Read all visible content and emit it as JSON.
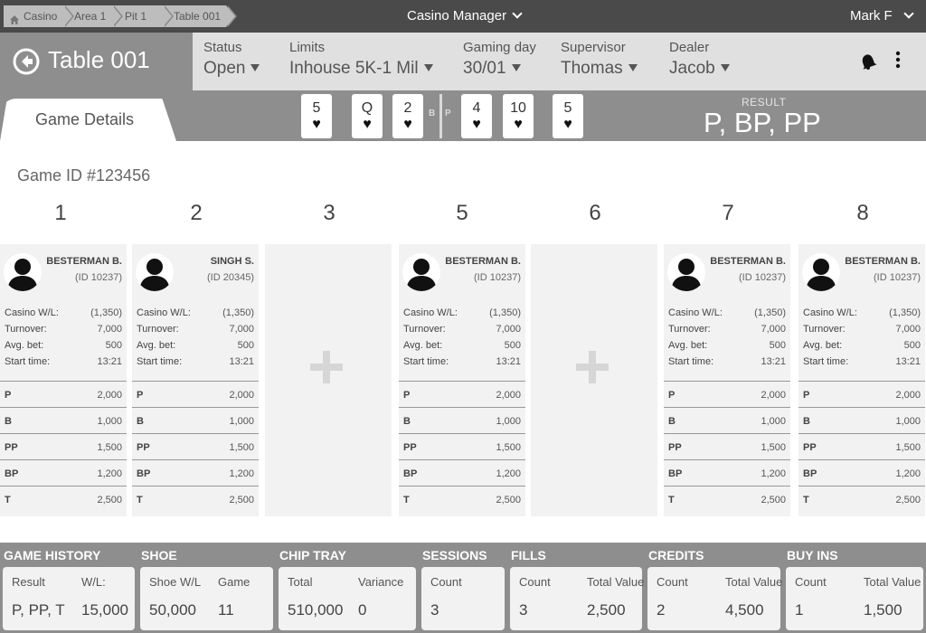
{
  "breadcrumb": {
    "items": [
      "Casino",
      "Area 1",
      "Pit 1",
      "Table 001"
    ],
    "home_icon": "home-icon"
  },
  "app_title": "Casino Manager",
  "user_name": "Mark F",
  "header": {
    "table_title": "Table 001",
    "status": {
      "label": "Status",
      "value": "Open"
    },
    "limits": {
      "label": "Limits",
      "value": "Inhouse 5K-1 Mil"
    },
    "gaming_day": {
      "label": "Gaming day",
      "value": "30/01"
    },
    "supervisor": {
      "label": "Supervisor",
      "value": "Thomas"
    },
    "dealer": {
      "label": "Dealer",
      "value": "Jacob"
    }
  },
  "game": {
    "tab_label": "Game Details",
    "banker_cards": [
      {
        "rank": "5",
        "suit": "♥"
      },
      {
        "rank": "Q",
        "suit": "♥"
      },
      {
        "rank": "2",
        "suit": "♥"
      }
    ],
    "player_cards": [
      {
        "rank": "4",
        "suit": "♥"
      },
      {
        "rank": "10",
        "suit": "♥"
      },
      {
        "rank": "5",
        "suit": "♥"
      }
    ],
    "banker_label": "B",
    "player_label": "P",
    "result_label": "RESULT",
    "result_value": "P, BP, PP",
    "game_id": "Game ID #123456"
  },
  "seats": [
    {
      "number": "1",
      "occupied": true,
      "name": "BESTERMAN B.",
      "id": "(ID 10237)",
      "stats": [
        {
          "k": "Casino W/L:",
          "v": "(1,350)"
        },
        {
          "k": "Turnover:",
          "v": "7,000"
        },
        {
          "k": "Avg. bet:",
          "v": "500"
        },
        {
          "k": "Start time:",
          "v": "13:21"
        }
      ],
      "bets": [
        {
          "k": "P",
          "v": "2,000"
        },
        {
          "k": "B",
          "v": "1,000"
        },
        {
          "k": "PP",
          "v": "1,500"
        },
        {
          "k": "BP",
          "v": "1,200"
        },
        {
          "k": "T",
          "v": "2,500"
        }
      ]
    },
    {
      "number": "2",
      "occupied": true,
      "name": "SINGH S.",
      "id": "(ID 20345)",
      "stats": [
        {
          "k": "Casino W/L:",
          "v": "(1,350)"
        },
        {
          "k": "Turnover:",
          "v": "7,000"
        },
        {
          "k": "Avg. bet:",
          "v": "500"
        },
        {
          "k": "Start time:",
          "v": "13:21"
        }
      ],
      "bets": [
        {
          "k": "P",
          "v": "2,000"
        },
        {
          "k": "B",
          "v": "1,000"
        },
        {
          "k": "PP",
          "v": "1,500"
        },
        {
          "k": "BP",
          "v": "1,200"
        },
        {
          "k": "T",
          "v": "2,500"
        }
      ]
    },
    {
      "number": "3",
      "occupied": false
    },
    {
      "number": "5",
      "occupied": true,
      "name": "BESTERMAN B.",
      "id": "(ID 10237)",
      "stats": [
        {
          "k": "Casino W/L:",
          "v": "(1,350)"
        },
        {
          "k": "Turnover:",
          "v": "7,000"
        },
        {
          "k": "Avg. bet:",
          "v": "500"
        },
        {
          "k": "Start time:",
          "v": "13:21"
        }
      ],
      "bets": [
        {
          "k": "P",
          "v": "2,000"
        },
        {
          "k": "B",
          "v": "1,000"
        },
        {
          "k": "PP",
          "v": "1,500"
        },
        {
          "k": "BP",
          "v": "1,200"
        },
        {
          "k": "T",
          "v": "2,500"
        }
      ]
    },
    {
      "number": "6",
      "occupied": false
    },
    {
      "number": "7",
      "occupied": true,
      "name": "BESTERMAN B.",
      "id": "(ID 10237)",
      "stats": [
        {
          "k": "Casino W/L:",
          "v": "(1,350)"
        },
        {
          "k": "Turnover:",
          "v": "7,000"
        },
        {
          "k": "Avg. bet:",
          "v": "500"
        },
        {
          "k": "Start time:",
          "v": "13:21"
        }
      ],
      "bets": [
        {
          "k": "P",
          "v": "2,000"
        },
        {
          "k": "B",
          "v": "1,000"
        },
        {
          "k": "PP",
          "v": "1,500"
        },
        {
          "k": "BP",
          "v": "1,200"
        },
        {
          "k": "T",
          "v": "2,500"
        }
      ]
    },
    {
      "number": "8",
      "occupied": true,
      "name": "BESTERMAN B.",
      "id": "(ID 10237)",
      "stats": [
        {
          "k": "Casino W/L:",
          "v": "(1,350)"
        },
        {
          "k": "Turnover:",
          "v": "7,000"
        },
        {
          "k": "Avg. bet:",
          "v": "500"
        },
        {
          "k": "Start time:",
          "v": "13:21"
        }
      ],
      "bets": [
        {
          "k": "P",
          "v": "2,000"
        },
        {
          "k": "B",
          "v": "1,000"
        },
        {
          "k": "PP",
          "v": "1,500"
        },
        {
          "k": "BP",
          "v": "1,200"
        },
        {
          "k": "T",
          "v": "2,500"
        }
      ]
    }
  ],
  "footer": [
    {
      "title": "GAME HISTORY",
      "cols": [
        {
          "label": "Result",
          "value": "P, PP, T"
        },
        {
          "label": "W/L:",
          "value": "15,000"
        }
      ]
    },
    {
      "title": "SHOE",
      "cols": [
        {
          "label": "Shoe W/L",
          "value": "50,000"
        },
        {
          "label": "Game",
          "value": "11"
        }
      ]
    },
    {
      "title": "CHIP TRAY",
      "cols": [
        {
          "label": "Total",
          "value": "510,000"
        },
        {
          "label": "Variance",
          "value": "0"
        }
      ]
    },
    {
      "title": "SESSIONS",
      "cols": [
        {
          "label": "Count",
          "value": "3"
        }
      ]
    },
    {
      "title": "FILLS",
      "cols": [
        {
          "label": "Count",
          "value": "3"
        },
        {
          "label": "Total Value",
          "value": "2,500"
        }
      ]
    },
    {
      "title": "CREDITS",
      "cols": [
        {
          "label": "Count",
          "value": "2"
        },
        {
          "label": "Total Value",
          "value": "4,500"
        }
      ]
    },
    {
      "title": "BUY INS",
      "cols": [
        {
          "label": "Count",
          "value": "1"
        },
        {
          "label": "Total Value",
          "value": "1,500"
        }
      ]
    }
  ],
  "colors": {
    "dark_bar": "#4a4a4a",
    "mid_gray": "#8e8e8e",
    "light_panel": "#e0e0e0",
    "seat_bg": "#f2f2f2"
  }
}
